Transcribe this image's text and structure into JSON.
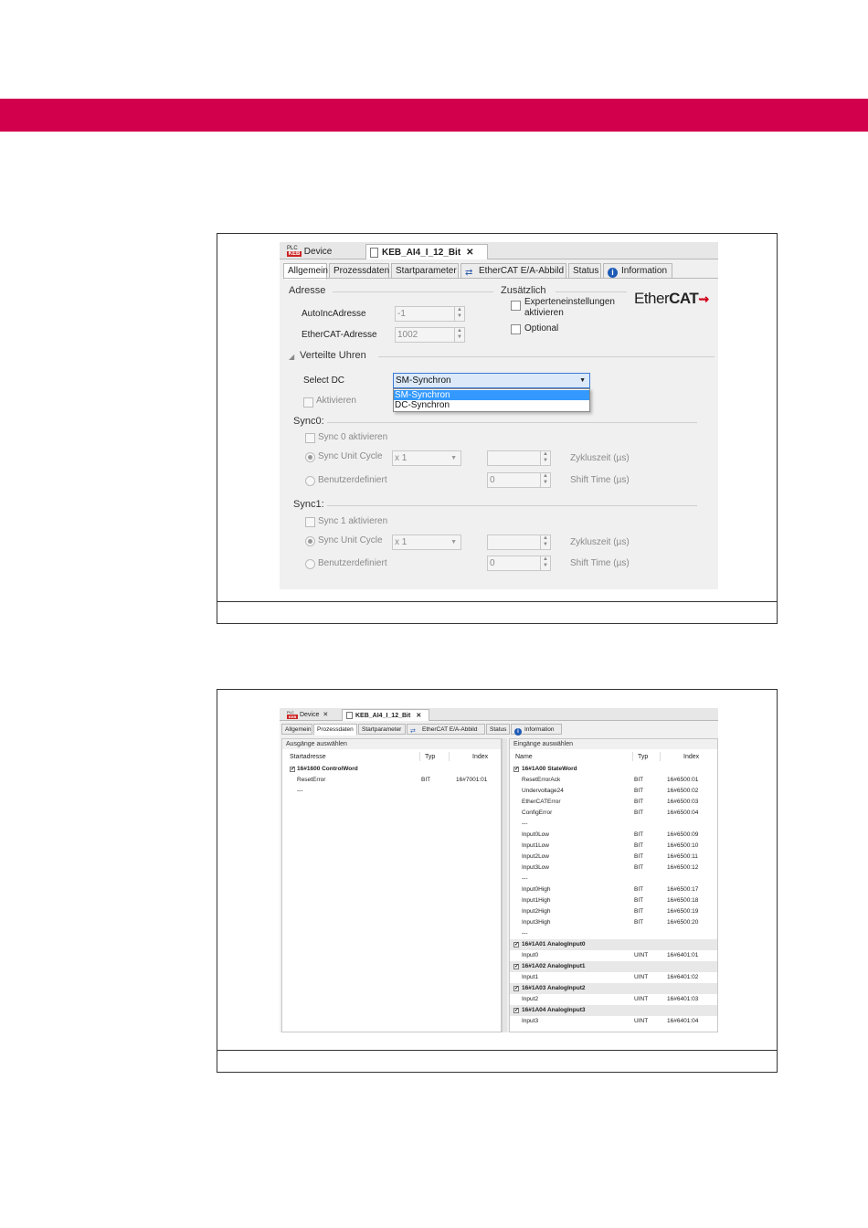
{
  "editor_tabs": {
    "plc_badge_top": "PLC",
    "plc_badge_bottom": "KEB",
    "device": "Device",
    "active": "KEB_AI4_I_12_Bit",
    "close": "✕"
  },
  "page_tabs": [
    "Allgemein",
    "Prozessdaten",
    "Startparameter",
    "EtherCAT E/A-Abbild",
    "Status",
    "Information"
  ],
  "general": {
    "address_section": "Adresse",
    "autoinc_label": "AutoIncAdresse",
    "autoinc_value": "-1",
    "ethercat_addr_label": "EtherCAT-Adresse",
    "ethercat_addr_value": "1002",
    "extra_section": "Zusätzlich",
    "expert_label_1": "Experteneinstellungen",
    "expert_label_2": "aktivieren",
    "optional_label": "Optional",
    "logo_text_1": "Ether",
    "logo_text_2": "CAT",
    "logo_mark": "⇝",
    "dc_section": "Verteilte Uhren",
    "select_dc_label": "Select DC",
    "select_dc_value": "SM-Synchron",
    "dropdown_options": [
      "SM-Synchron",
      "DC-Synchron"
    ],
    "activate_label": "Aktivieren",
    "sync0_title": "Sync0:",
    "sync0_activate": "Sync 0 aktivieren",
    "sync1_title": "Sync1:",
    "sync1_activate": "Sync 1 aktivieren",
    "sync_unit_cycle": "Sync Unit Cycle",
    "unit_cycle_value": "x 1",
    "cycle_time_label": "Zykluszeit (µs)",
    "user_defined": "Benutzerdefiniert",
    "shift_value": "0",
    "shift_time_label": "Shift Time (µs)"
  },
  "processdata": {
    "outputs_title": "Ausgänge auswählen",
    "inputs_title": "Eingänge auswählen",
    "out_columns": [
      "Startadresse",
      "Typ",
      "Index"
    ],
    "in_columns": [
      "Name",
      "Typ",
      "Index"
    ],
    "output_rows": [
      {
        "name": "16#1600 ControlWord",
        "type": "",
        "index": "",
        "group": true,
        "checked": true
      },
      {
        "name": "ResetError",
        "type": "BIT",
        "index": "16#7001:01",
        "group": false
      },
      {
        "name": "---",
        "type": "",
        "index": "",
        "group": false
      }
    ],
    "input_rows": [
      {
        "name": "16#1A00 StateWord",
        "type": "",
        "index": "",
        "group": true,
        "checked": true
      },
      {
        "name": "ResetErrorAck",
        "type": "BIT",
        "index": "16#6500:01",
        "group": false
      },
      {
        "name": "Undervoltage24",
        "type": "BIT",
        "index": "16#6500:02",
        "group": false
      },
      {
        "name": "EtherCATError",
        "type": "BIT",
        "index": "16#6500:03",
        "group": false
      },
      {
        "name": "ConfigError",
        "type": "BIT",
        "index": "16#6500:04",
        "group": false
      },
      {
        "name": "---",
        "type": "",
        "index": "",
        "group": false
      },
      {
        "name": "Input0Low",
        "type": "BIT",
        "index": "16#6500:09",
        "group": false
      },
      {
        "name": "Input1Low",
        "type": "BIT",
        "index": "16#6500:10",
        "group": false
      },
      {
        "name": "Input2Low",
        "type": "BIT",
        "index": "16#6500:11",
        "group": false
      },
      {
        "name": "Input3Low",
        "type": "BIT",
        "index": "16#6500:12",
        "group": false
      },
      {
        "name": "---",
        "type": "",
        "index": "",
        "group": false
      },
      {
        "name": "Input0High",
        "type": "BIT",
        "index": "16#6500:17",
        "group": false
      },
      {
        "name": "Input1High",
        "type": "BIT",
        "index": "16#6500:18",
        "group": false
      },
      {
        "name": "Input2High",
        "type": "BIT",
        "index": "16#6500:19",
        "group": false
      },
      {
        "name": "Input3High",
        "type": "BIT",
        "index": "16#6500:20",
        "group": false
      },
      {
        "name": "---",
        "type": "",
        "index": "",
        "group": false
      },
      {
        "name": "16#1A01 AnalogInput0",
        "type": "",
        "index": "",
        "group": true,
        "checked": true
      },
      {
        "name": "Input0",
        "type": "UINT",
        "index": "16#6401:01",
        "group": false
      },
      {
        "name": "16#1A02 AnalogInput1",
        "type": "",
        "index": "",
        "group": true,
        "checked": true
      },
      {
        "name": "Input1",
        "type": "UINT",
        "index": "16#6401:02",
        "group": false
      },
      {
        "name": "16#1A03 AnalogInput2",
        "type": "",
        "index": "",
        "group": true,
        "checked": true
      },
      {
        "name": "Input2",
        "type": "UINT",
        "index": "16#6401:03",
        "group": false
      },
      {
        "name": "16#1A04 AnalogInput3",
        "type": "",
        "index": "",
        "group": true,
        "checked": true
      },
      {
        "name": "Input3",
        "type": "UINT",
        "index": "16#6401:04",
        "group": false
      }
    ]
  },
  "colors": {
    "brand_band": "#d2004c",
    "selection": "#3399ff"
  }
}
